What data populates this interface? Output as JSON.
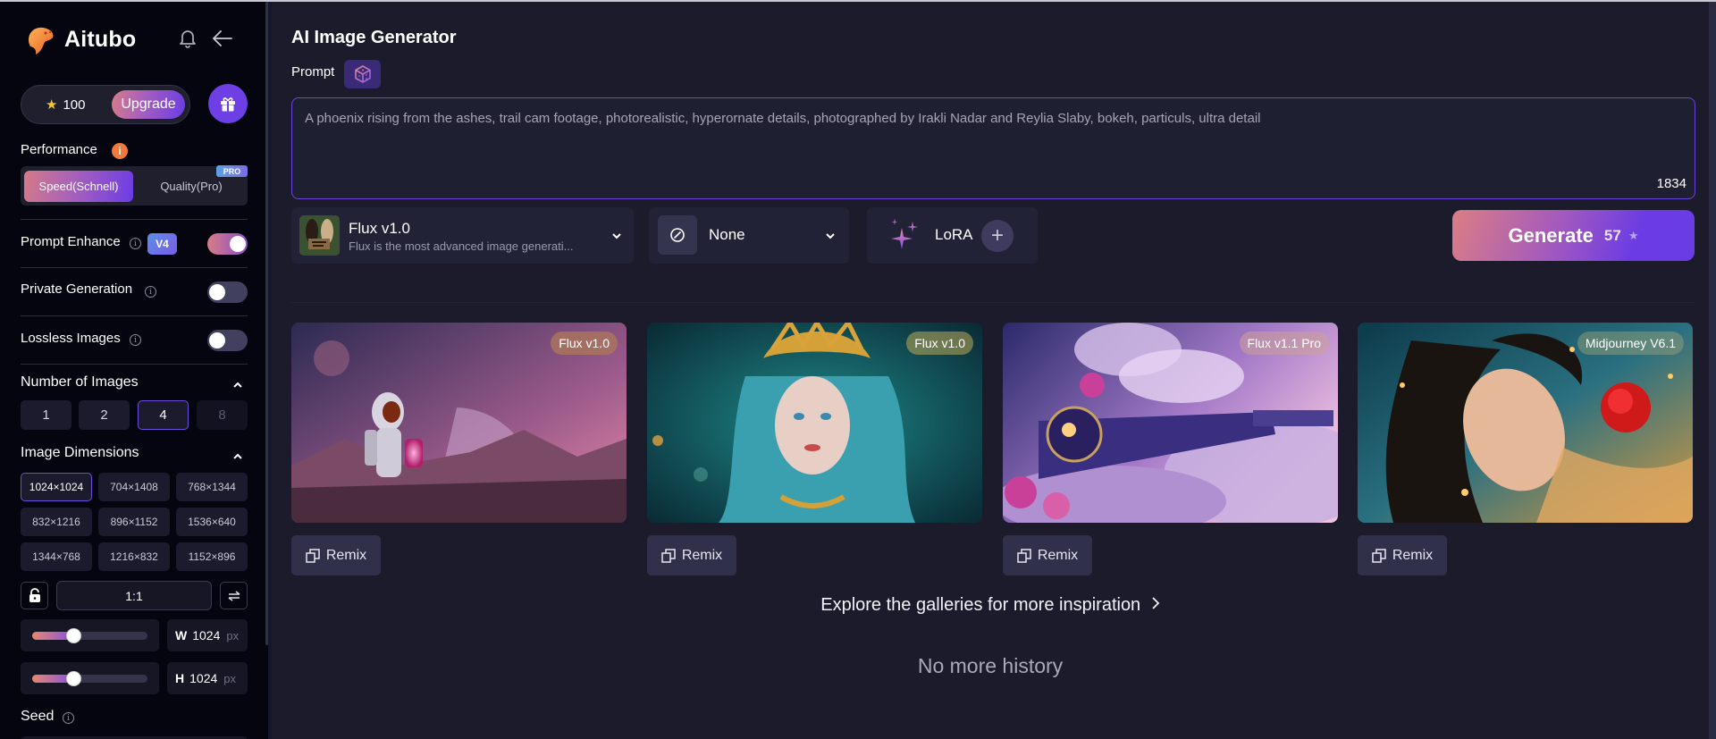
{
  "sidebar": {
    "brand": "Aitubo",
    "credits": "100",
    "upgrade_label": "Upgrade",
    "performance": {
      "label": "Performance",
      "options": [
        "Speed(Schnell)",
        "Quality(Pro)"
      ],
      "selected": "Speed(Schnell)",
      "pro_badge": "PRO"
    },
    "prompt_enhance": {
      "label": "Prompt Enhance",
      "badge": "V4",
      "enabled": true
    },
    "private_generation": {
      "label": "Private Generation",
      "enabled": false
    },
    "lossless_images": {
      "label": "Lossless Images",
      "enabled": false
    },
    "number_of_images": {
      "label": "Number of Images",
      "options": [
        "1",
        "2",
        "4",
        "8"
      ],
      "selected": "4",
      "disabled": [
        "8"
      ]
    },
    "image_dimensions": {
      "label": "Image Dimensions",
      "options": [
        "1024×1024",
        "704×1408",
        "768×1344",
        "832×1216",
        "896×1152",
        "1536×640",
        "1344×768",
        "1216×832",
        "1152×896"
      ],
      "selected": "1024×1024"
    },
    "aspect_ratio": "1:1",
    "width": {
      "axis": "W",
      "value": "1024",
      "unit": "px",
      "slider_fraction": 0.36
    },
    "height": {
      "axis": "H",
      "value": "1024",
      "unit": "px",
      "slider_fraction": 0.36
    },
    "seed_label": "Seed"
  },
  "main": {
    "title": "AI Image Generator",
    "prompt_label": "Prompt",
    "prompt_text": "A phoenix rising from the ashes, trail cam footage, photorealistic, hyperornate details, photographed by Irakli Nadar and Reylia Slaby, bokeh, particuls, ultra detail",
    "char_count": "1834",
    "model": {
      "name": "Flux v1.0",
      "description": "Flux is the most advanced image generati..."
    },
    "style": {
      "name": "None"
    },
    "lora_label": "LoRA",
    "generate": {
      "label": "Generate",
      "cost": "57"
    },
    "gallery": [
      {
        "badge": "Flux v1.0",
        "remix": "Remix",
        "scene": "astronaut"
      },
      {
        "badge": "Flux v1.0",
        "remix": "Remix",
        "scene": "goddess"
      },
      {
        "badge": "Flux v1.1 Pro",
        "remix": "Remix",
        "scene": "train"
      },
      {
        "badge": "Midjourney V6.1",
        "remix": "Remix",
        "scene": "water"
      }
    ],
    "explore_link": "Explore the galleries for more inspiration",
    "no_history": "No more history"
  },
  "colors": {
    "accent": "#6b3ce4",
    "gradient_start": "#d77c88",
    "sidebar_bg": "#05050f",
    "main_bg": "#1b1b2b",
    "credit_star": "#f8c81c",
    "info_orange": "#f07a3b"
  }
}
